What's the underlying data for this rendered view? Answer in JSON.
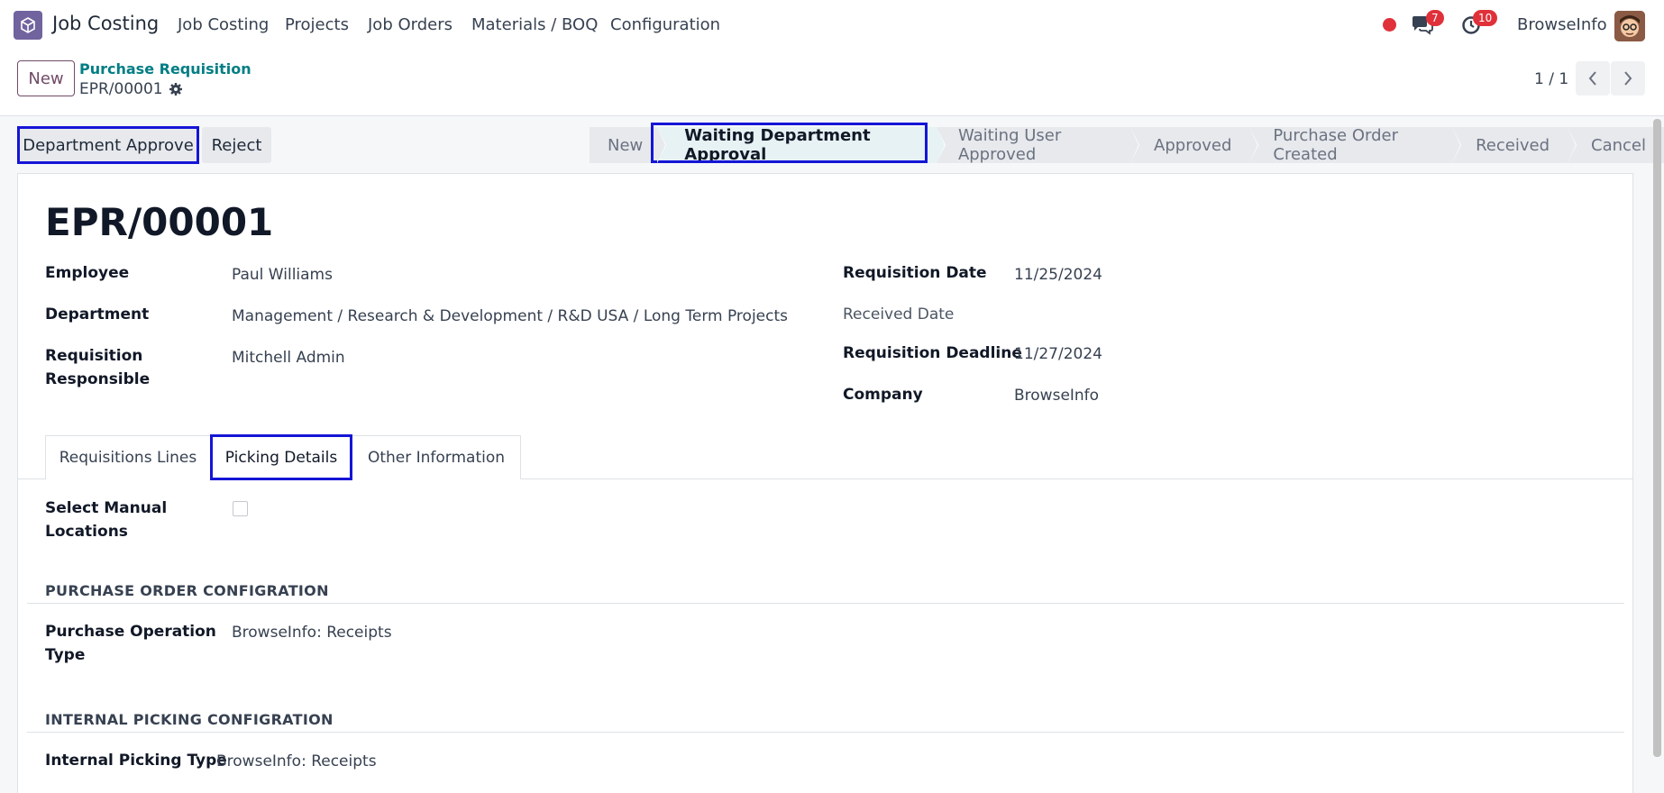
{
  "navbar": {
    "app_name": "Job Costing",
    "menus": [
      "Job Costing",
      "Projects",
      "Job Orders",
      "Materials / BOQ",
      "Configuration"
    ],
    "messages_count": "7",
    "activities_count": "10",
    "company": "BrowseInfo"
  },
  "control_panel": {
    "new_label": "New",
    "breadcrumb_parent": "Purchase Requisition",
    "breadcrumb_current": "EPR/00001",
    "pager": "1 / 1"
  },
  "actions": {
    "department_approve": "Department Approve",
    "reject": "Reject"
  },
  "statusbar": {
    "stages": [
      "New",
      "Waiting Department Approval",
      "Waiting User Approved",
      "Approved",
      "Purchase Order Created",
      "Received",
      "Cancel"
    ],
    "active": "Waiting Department Approval"
  },
  "form": {
    "title": "EPR/00001",
    "employee_label": "Employee",
    "employee": "Paul Williams",
    "department_label": "Department",
    "department": "Management / Research & Development / R&D USA / Long Term Projects",
    "responsible_label_1": "Requisition",
    "responsible_label_2": "Responsible",
    "responsible": "Mitchell Admin",
    "req_date_label": "Requisition Date",
    "req_date": "11/25/2024",
    "received_date_label": "Received Date",
    "deadline_label": "Requisition Deadline",
    "deadline": "11/27/2024",
    "company_label": "Company",
    "company": "BrowseInfo"
  },
  "tabs": [
    "Requisitions Lines",
    "Picking Details",
    "Other Information"
  ],
  "picking": {
    "manual_label_1": "Select Manual",
    "manual_label_2": "Locations",
    "po_section": "PURCHASE ORDER CONFIGRATION",
    "po_type_label_1": "Purchase Operation",
    "po_type_label_2": "Type",
    "po_type": "BrowseInfo: Receipts",
    "internal_section": "INTERNAL PICKING CONFIGRATION",
    "internal_type_label": "Internal Picking Type",
    "internal_type": "BrowseInfo: Receipts"
  },
  "colors": {
    "brand": "#714b67",
    "link": "#017e84",
    "highlight": "#1515d6",
    "badge": "#e0313a"
  }
}
